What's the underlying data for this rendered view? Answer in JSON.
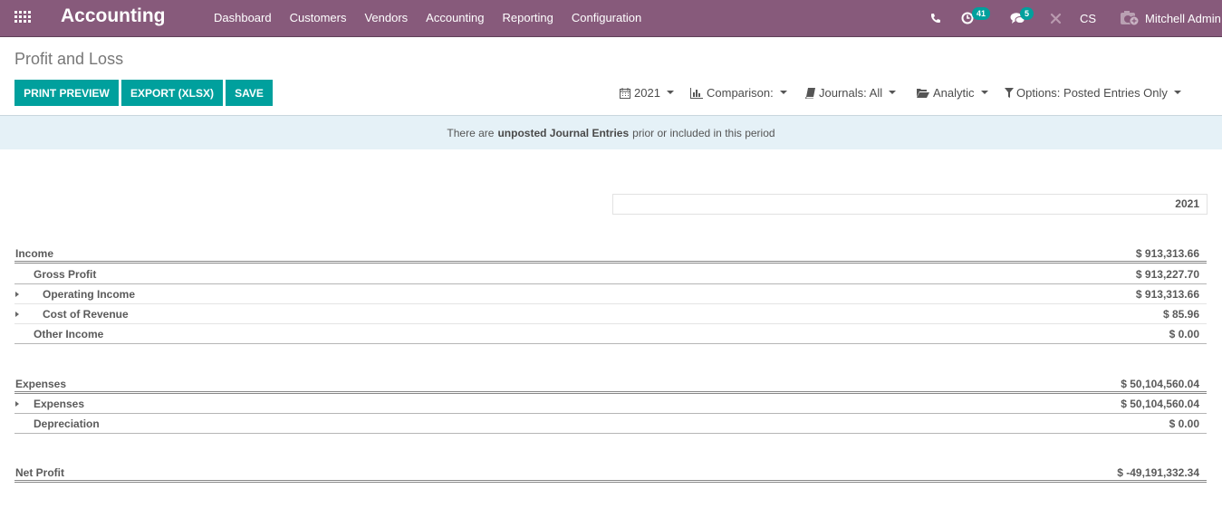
{
  "navbar": {
    "app_name": "Accounting",
    "menu": [
      "Dashboard",
      "Customers",
      "Vendors",
      "Accounting",
      "Reporting",
      "Configuration"
    ],
    "activity_count": "41",
    "messages_count": "5",
    "company": "CS",
    "user": "Mitchell Admin",
    "colors": {
      "bar": "#875a7b",
      "badge": "#00a09d"
    }
  },
  "control_panel": {
    "title": "Profit and Loss",
    "buttons": [
      "PRINT PREVIEW",
      "EXPORT (XLSX)",
      "SAVE"
    ],
    "filters": {
      "date": "2021",
      "comparison": "Comparison:",
      "journals": "Journals: All",
      "analytic": "Analytic",
      "options": "Options: Posted Entries Only"
    }
  },
  "alert": {
    "prefix": "There are",
    "bold": "unposted Journal Entries",
    "suffix": "prior or included in this period"
  },
  "report": {
    "column_header": "2021",
    "rows": [
      {
        "label": "Income",
        "amount": "$ 913,313.66",
        "level": 0,
        "expandable": false
      },
      {
        "label": "Gross Profit",
        "amount": "$ 913,227.70",
        "level": 1,
        "expandable": false
      },
      {
        "label": "Operating Income",
        "amount": "$ 913,313.66",
        "level": 2,
        "expandable": true
      },
      {
        "label": "Cost of Revenue",
        "amount": "$ 85.96",
        "level": 2,
        "expandable": true
      },
      {
        "label": "Other Income",
        "amount": "$ 0.00",
        "level": 1,
        "expandable": false
      },
      {
        "label": "Expenses",
        "amount": "$ 50,104,560.04",
        "level": 0,
        "expandable": false
      },
      {
        "label": "Expenses",
        "amount": "$ 50,104,560.04",
        "level": 1,
        "expandable": true
      },
      {
        "label": "Depreciation",
        "amount": "$ 0.00",
        "level": 1,
        "expandable": false
      },
      {
        "label": "Net Profit",
        "amount": "$ -49,191,332.34",
        "level": 0,
        "expandable": false
      }
    ]
  }
}
